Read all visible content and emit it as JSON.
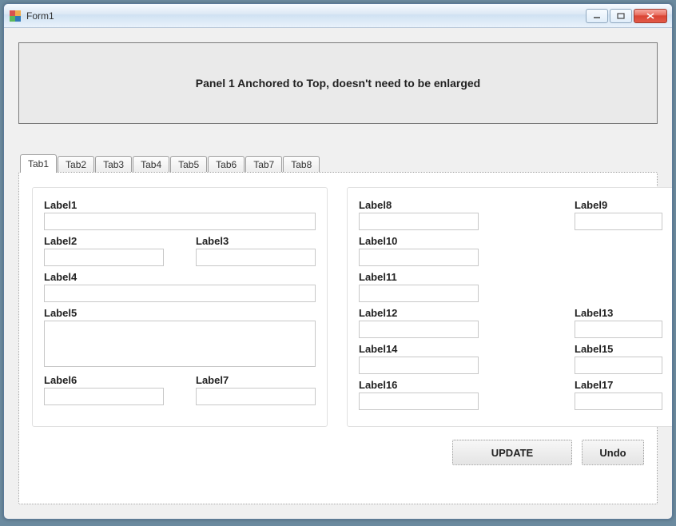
{
  "window": {
    "title": "Form1"
  },
  "panel1": {
    "text": "Panel 1 Anchored to Top, doesn't need to be enlarged"
  },
  "tabs": [
    "Tab1",
    "Tab2",
    "Tab3",
    "Tab4",
    "Tab5",
    "Tab6",
    "Tab7",
    "Tab8"
  ],
  "active_tab": "Tab1",
  "left": {
    "label1": "Label1",
    "label2": "Label2",
    "label3": "Label3",
    "label4": "Label4",
    "label5": "Label5",
    "label6": "Label6",
    "label7": "Label7",
    "val1": "",
    "val2": "",
    "val3": "",
    "val4": "",
    "val5": "",
    "val6": "",
    "val7": ""
  },
  "right": {
    "label8": "Label8",
    "label9": "Label9",
    "label10": "Label10",
    "label11": "Label11",
    "label12": "Label12",
    "label13": "Label13",
    "label14": "Label14",
    "label15": "Label15",
    "label16": "Label16",
    "label17": "Label17",
    "val8": "",
    "val9": "",
    "val10": "",
    "val11": "",
    "val12": "",
    "val13": "",
    "val14": "",
    "val15": "",
    "val16": "",
    "val17": ""
  },
  "buttons": {
    "update": "UPDATE",
    "undo": "Undo"
  }
}
